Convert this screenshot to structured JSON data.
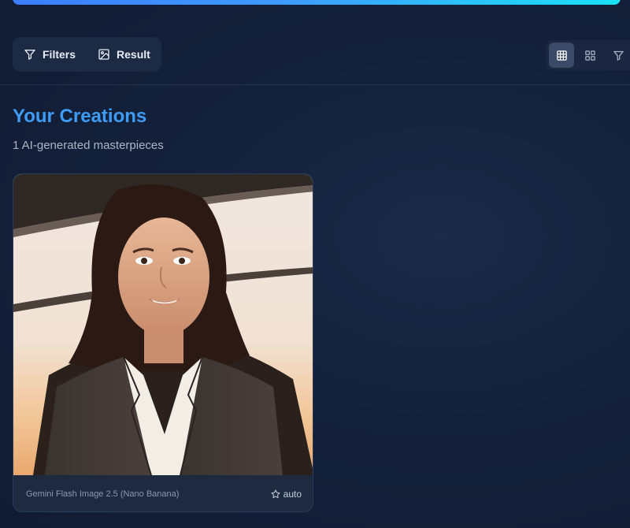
{
  "toolbar": {
    "filters_label": "Filters",
    "result_label": "Result"
  },
  "view_switcher": {
    "active": "grid-large",
    "icons": [
      "grid-large-icon",
      "grid-small-icon",
      "filter-icon"
    ]
  },
  "gallery": {
    "title": "Your Creations",
    "subtitle": "1 AI-generated masterpieces",
    "items": [
      {
        "model": "Gemini Flash Image 2.5 (Nano Banana)",
        "aspect": "auto"
      }
    ]
  },
  "colors": {
    "accent": "#3f9cf5",
    "gradient_start": "#3b7dff",
    "gradient_end": "#19e2f5",
    "background": "#14213b"
  }
}
